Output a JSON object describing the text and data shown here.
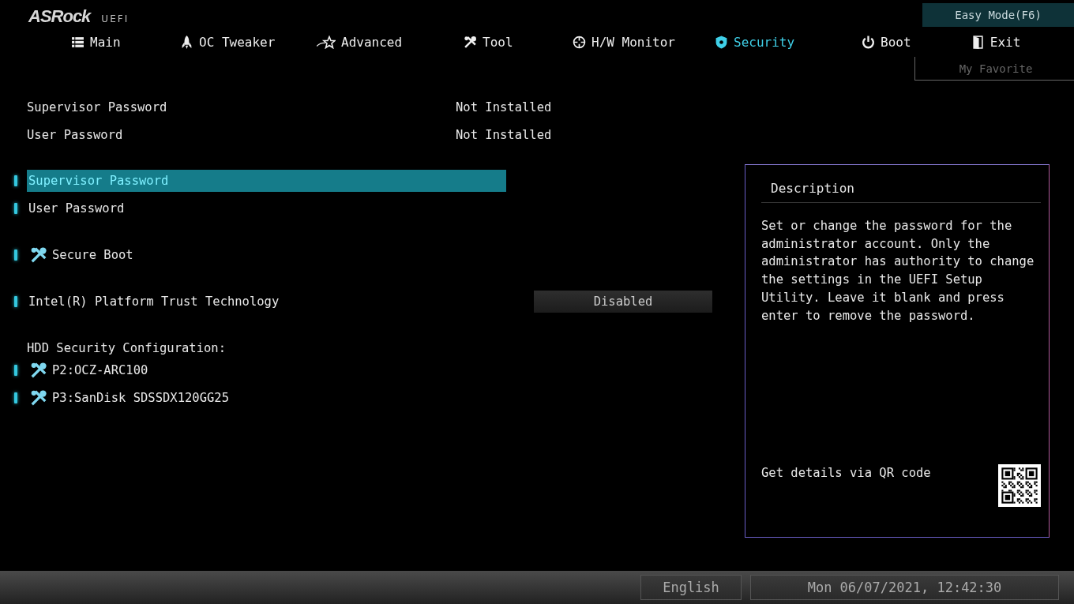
{
  "logo": {
    "brand": "ASRock",
    "suffix": "UEFI"
  },
  "tabs": [
    {
      "label": "Main",
      "selected": false
    },
    {
      "label": "OC Tweaker",
      "selected": false
    },
    {
      "label": "Advanced",
      "selected": false
    },
    {
      "label": "Tool",
      "selected": false
    },
    {
      "label": "H/W Monitor",
      "selected": false
    },
    {
      "label": "Security",
      "selected": true
    },
    {
      "label": "Boot",
      "selected": false
    },
    {
      "label": "Exit",
      "selected": false
    }
  ],
  "easy_mode_button": "Easy Mode(F6)",
  "favorite_button": "My Favorite",
  "info_rows": [
    {
      "label": "Supervisor Password",
      "value": "Not Installed"
    },
    {
      "label": "User Password",
      "value": "Not Installed"
    }
  ],
  "menu_groups": [
    [
      {
        "kind": "item",
        "label": "Supervisor Password",
        "selected": true
      },
      {
        "kind": "item",
        "label": "User Password",
        "selected": false
      }
    ],
    [
      {
        "kind": "submenu",
        "label": "Secure Boot",
        "selected": false
      }
    ],
    [
      {
        "kind": "option",
        "label": "Intel(R) Platform Trust Technology",
        "value": "Disabled",
        "selected": false
      }
    ],
    [
      {
        "kind": "heading",
        "label": "HDD Security Configuration:"
      },
      {
        "kind": "submenu",
        "label": "P2:OCZ-ARC100",
        "selected": false
      },
      {
        "kind": "submenu",
        "label": "P3:SanDisk SDSSDX120GG25",
        "selected": false
      }
    ]
  ],
  "description": {
    "title": "Description",
    "text": "Set or change the password for the administrator account. Only the administrator has authority to change the settings in the UEFI Setup Utility. Leave it blank and press enter to remove the password.",
    "qr_hint": "Get details via QR code"
  },
  "status_bar": {
    "language": "English",
    "datetime": "Mon 06/07/2021, 12:42:30"
  }
}
